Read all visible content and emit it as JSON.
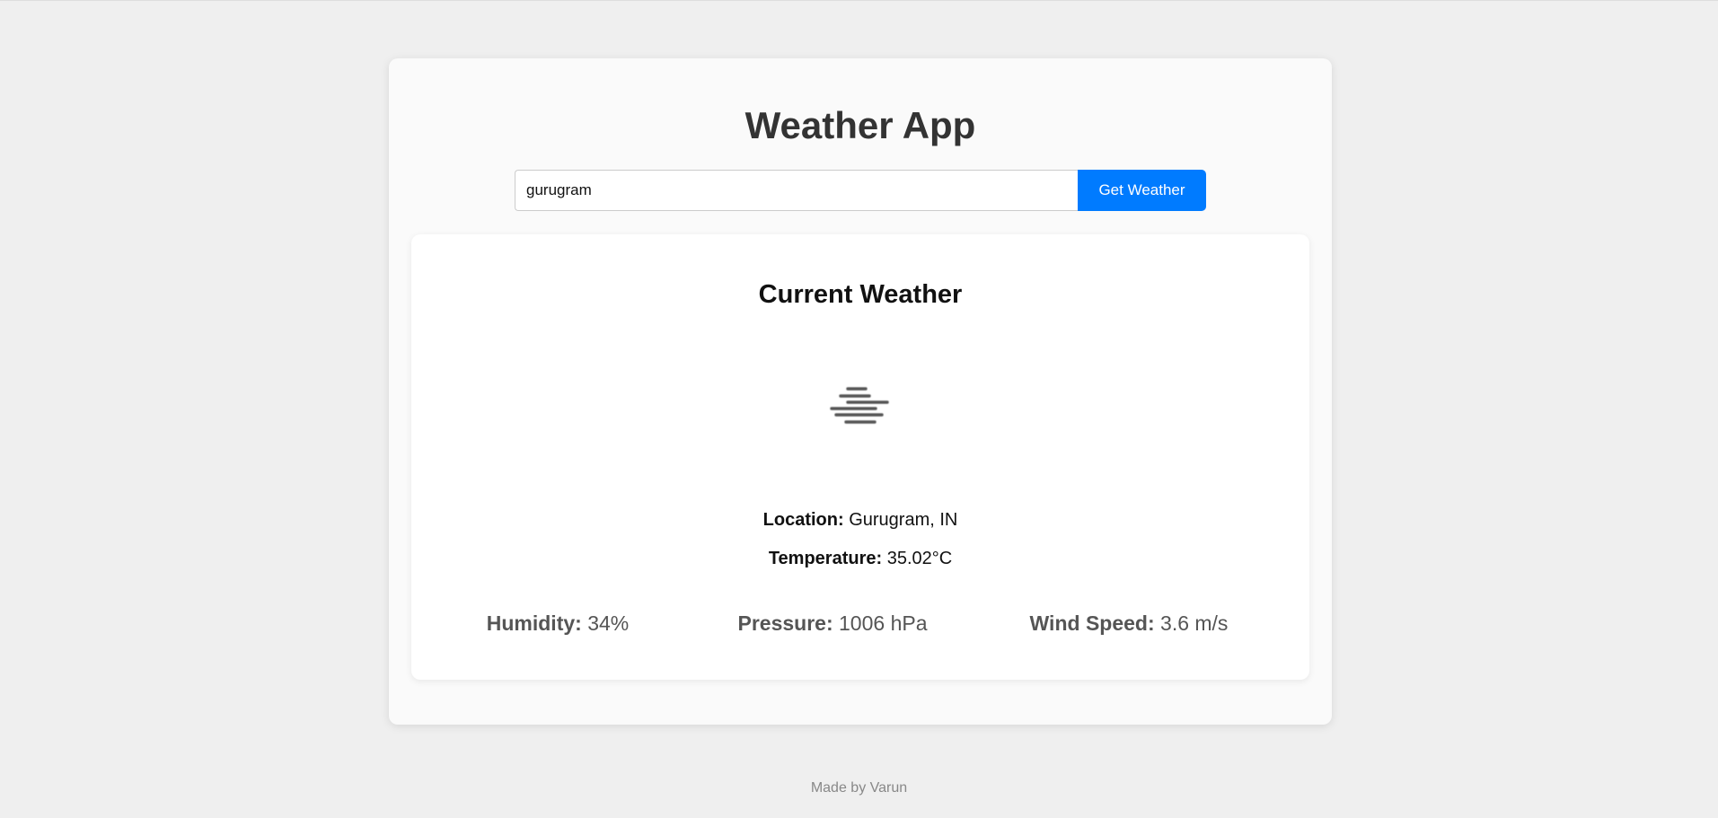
{
  "app": {
    "title": "Weather App"
  },
  "search": {
    "value": "gurugram",
    "button_label": "Get Weather"
  },
  "weather": {
    "heading": "Current Weather",
    "icon": "mist-icon",
    "location_label": "Location:",
    "location_value": " Gurugram, IN",
    "temperature_label": "Temperature:",
    "temperature_value": " 35.02°C",
    "humidity_label": "Humidity:",
    "humidity_value": " 34%",
    "pressure_label": "Pressure:",
    "pressure_value": " 1006 hPa",
    "wind_label": "Wind Speed:",
    "wind_value": " 3.6 m/s"
  },
  "footer": {
    "text": "Made by Varun"
  },
  "colors": {
    "accent": "#007bff",
    "background": "#efefef",
    "card": "#fafafa"
  }
}
